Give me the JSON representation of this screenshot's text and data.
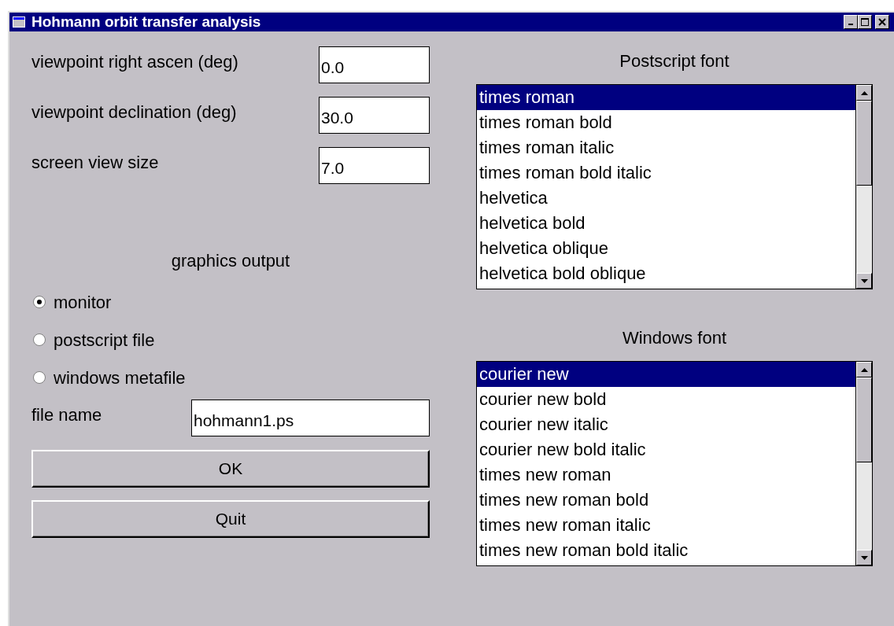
{
  "window": {
    "title": "Hohmann orbit transfer analysis"
  },
  "fields": [
    {
      "label": "viewpoint right ascen (deg)",
      "value": "0.0"
    },
    {
      "label": "viewpoint declination (deg)",
      "value": "30.0"
    },
    {
      "label": "screen view size",
      "value": "7.0"
    }
  ],
  "graphics_output": {
    "label": "graphics output",
    "options": [
      {
        "label": "monitor",
        "selected": true
      },
      {
        "label": "postscript file",
        "selected": false
      },
      {
        "label": "windows metafile",
        "selected": false
      }
    ]
  },
  "file_name": {
    "label": "file name",
    "value": "hohmann1.ps"
  },
  "buttons": [
    "OK",
    "Quit"
  ],
  "lists": [
    {
      "label": "Postscript font",
      "items": [
        {
          "label": "times roman",
          "selected": true
        },
        {
          "label": "times roman bold",
          "selected": false
        },
        {
          "label": "times roman italic",
          "selected": false
        },
        {
          "label": "times roman bold italic",
          "selected": false
        },
        {
          "label": "helvetica",
          "selected": false
        },
        {
          "label": "helvetica bold",
          "selected": false
        },
        {
          "label": "helvetica oblique",
          "selected": false
        },
        {
          "label": "helvetica bold oblique",
          "selected": false
        }
      ]
    },
    {
      "label": "Windows font",
      "items": [
        {
          "label": "courier new",
          "selected": true
        },
        {
          "label": "courier new bold",
          "selected": false
        },
        {
          "label": "courier new italic",
          "selected": false
        },
        {
          "label": "courier new bold italic",
          "selected": false
        },
        {
          "label": "times new roman",
          "selected": false
        },
        {
          "label": "times new roman bold",
          "selected": false
        },
        {
          "label": "times new roman italic",
          "selected": false
        },
        {
          "label": "times new roman bold italic",
          "selected": false
        }
      ]
    }
  ]
}
